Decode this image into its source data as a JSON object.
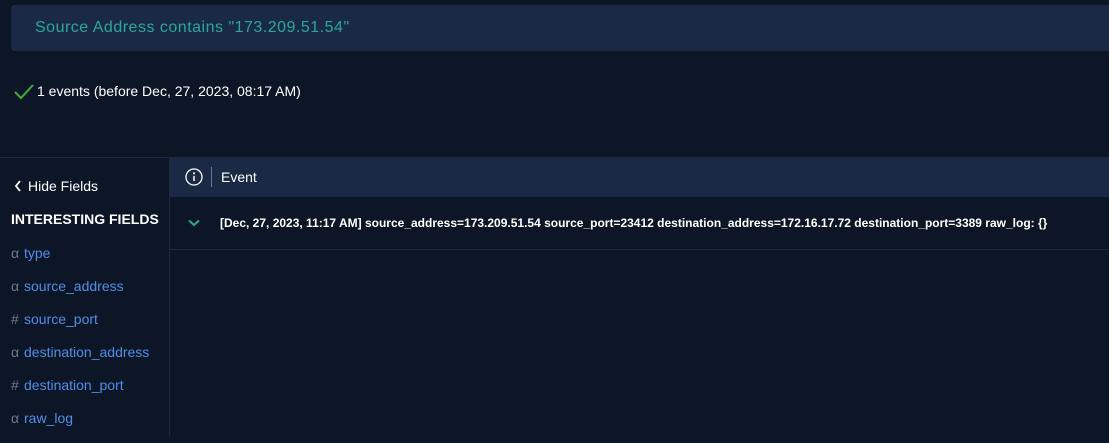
{
  "query": {
    "text": "Source Address contains \"173.209.51.54\""
  },
  "status": {
    "text": "1 events (before Dec, 27, 2023, 08:17 AM)"
  },
  "sidebar": {
    "hide_fields_label": "Hide Fields",
    "interesting_fields_title": "INTERESTING FIELDS",
    "fields": [
      {
        "type": "α",
        "name": "type"
      },
      {
        "type": "α",
        "name": "source_address"
      },
      {
        "type": "#",
        "name": "source_port"
      },
      {
        "type": "α",
        "name": "destination_address"
      },
      {
        "type": "#",
        "name": "destination_port"
      },
      {
        "type": "α",
        "name": "raw_log"
      }
    ]
  },
  "events": {
    "header_label": "Event",
    "rows": [
      {
        "text": "[Dec, 27, 2023, 11:17 AM] source_address=173.209.51.54 source_port=23412 destination_address=172.16.17.72 destination_port=3389 raw_log: {}"
      }
    ]
  },
  "colors": {
    "background": "#0d1626",
    "panel": "#1a2a44",
    "accent_teal": "#2aa6a0",
    "field_link": "#4f8ee8",
    "success_check": "#3fae3a"
  },
  "icons": {
    "status": "checkmark-icon",
    "hide_fields": "chevron-left-icon",
    "header": "info-icon",
    "row_expand": "chevron-down-icon"
  }
}
